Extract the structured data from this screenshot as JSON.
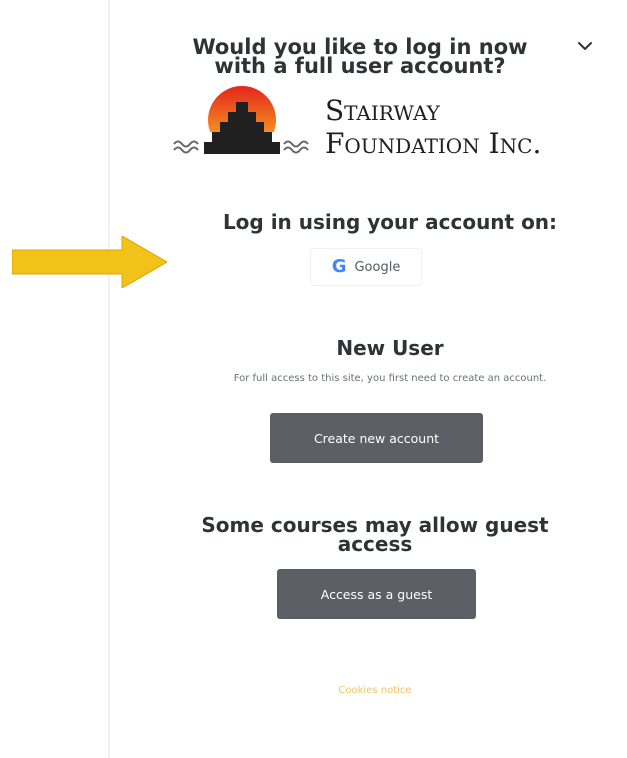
{
  "prompt": {
    "title_line1": "Would you like to log in now",
    "title_line2": "with a full user account?"
  },
  "icons": {
    "toggle": "chevron-down-icon",
    "google": "google-g-icon",
    "pointer": "arrow-right-icon"
  },
  "logo": {
    "line1": "Stairway",
    "line2": "Foundation Inc."
  },
  "login": {
    "heading": "Log in using your account on:",
    "google_icon_glyph": "G",
    "google_label": "Google"
  },
  "new_user": {
    "heading": "New User",
    "text": "For full access to this site, you first need to create an account.",
    "create_button": "Create new account"
  },
  "guest": {
    "heading_line1": "Some courses may allow guest",
    "heading_line2": "access",
    "button": "Access as a guest"
  },
  "footer": {
    "cookies": "Cookies notice"
  },
  "colors": {
    "button_bg": "#5c6066",
    "arrow": "#f2c21b",
    "link": "#f2c265",
    "google_blue": "#4285f4"
  }
}
